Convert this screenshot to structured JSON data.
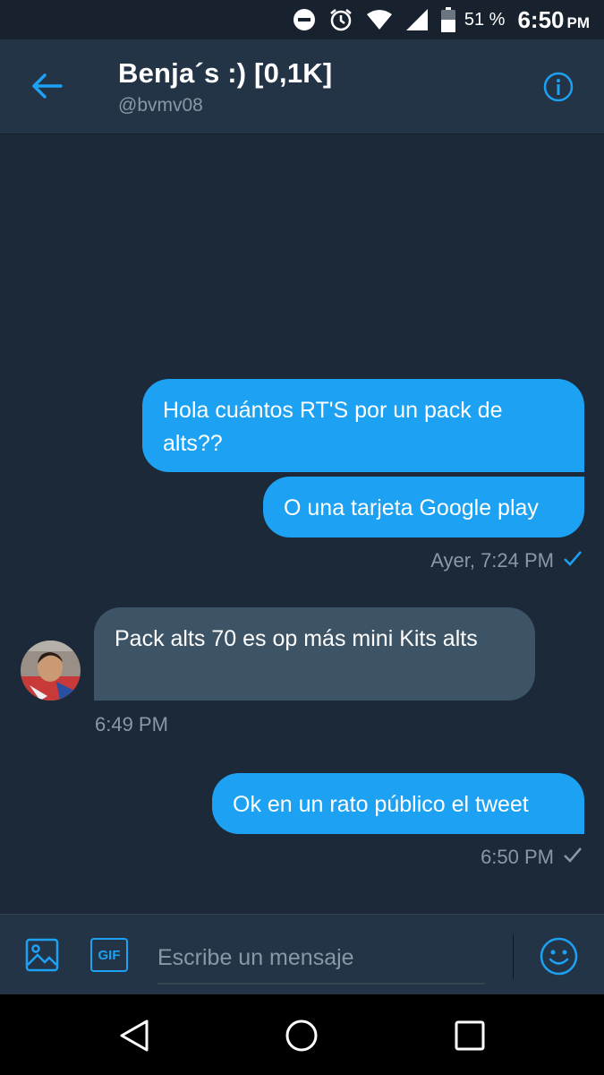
{
  "status_bar": {
    "battery_percent": "51 %",
    "time": "6:50",
    "ampm": "PM",
    "icons": [
      "dnd-icon",
      "alarm-icon",
      "wifi-icon",
      "signal-icon",
      "battery-icon"
    ]
  },
  "header": {
    "title": "Benja´s :) [0,1K]",
    "handle": "@bvmv08",
    "back_icon": "back-arrow-icon",
    "info_icon": "info-icon",
    "accent_color": "#1da1f2"
  },
  "messages": [
    {
      "direction": "sent",
      "text": "Hola cuántos RT'S por un pack de alts??"
    },
    {
      "direction": "sent",
      "text": "O una tarjeta Google play"
    },
    {
      "direction": "sent-meta",
      "text": "Ayer, 7:24 PM",
      "status": "read"
    },
    {
      "direction": "received",
      "text": "Pack alts 70 es op más mini Kits alts"
    },
    {
      "direction": "received-meta",
      "text": "6:49 PM"
    },
    {
      "direction": "sent",
      "text": "Ok en un rato público el tweet"
    },
    {
      "direction": "sent-meta",
      "text": "6:50 PM",
      "status": "sent"
    }
  ],
  "composer": {
    "placeholder": "Escribe un mensaje",
    "value": "",
    "gif_label": "GIF",
    "image_icon": "image-icon",
    "emoji_icon": "emoji-icon"
  },
  "nav": {
    "icons": [
      "nav-back-icon",
      "nav-home-icon",
      "nav-recents-icon"
    ]
  },
  "colors": {
    "background": "#1c2938",
    "header": "#243447",
    "sent_bubble": "#1da1f2",
    "received_bubble": "#3d5466",
    "muted_text": "#8899a6"
  }
}
